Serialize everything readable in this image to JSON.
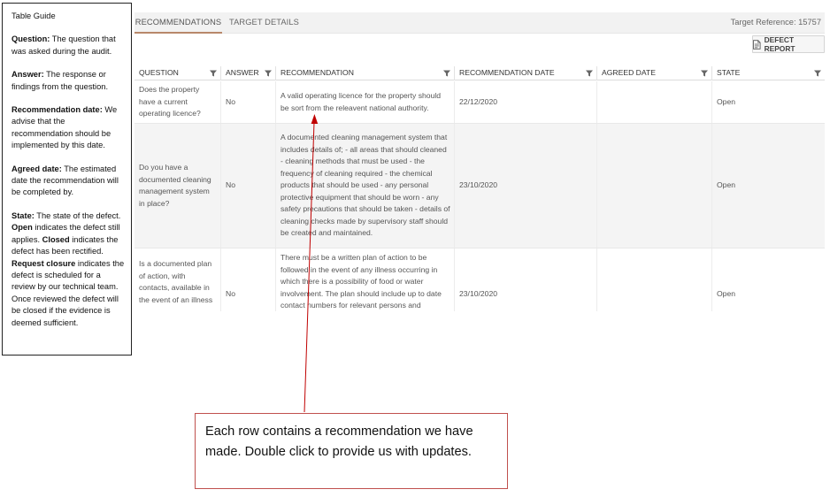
{
  "guide": {
    "title": "Table Guide",
    "question_term": "Question:",
    "question_text": " The question that was asked during the audit.",
    "answer_term": "Answer:",
    "answer_text": " The response or findings from the question.",
    "recdate_term": "Recommendation date:",
    "recdate_text": " We advise that the recommendation should be implemented by this date.",
    "agreed_term": "Agreed date:",
    "agreed_text": " The estimated date the recommendation will be completed by.",
    "state_term": "State:",
    "state_text1": " The state of the defect. ",
    "open_term": "Open",
    "state_text2": " indicates the defect still applies. ",
    "closed_term": "Closed",
    "state_text3": " indicates the defect has been rectified. ",
    "request_term": "Request closure",
    "state_text4": " indicates the defect is scheduled for a review by our technical team. Once reviewed the defect will be closed if the evidence is deemed sufficient."
  },
  "tabs": {
    "recommendations": "RECOMMENDATIONS",
    "target_details": "TARGET DETAILS"
  },
  "target_reference": "Target Reference: 15757",
  "defect_report_button": "DEFECT REPORT",
  "table": {
    "headers": [
      "QUESTION",
      "ANSWER",
      "RECOMMENDATION",
      "RECOMMENDATION DATE",
      "AGREED DATE",
      "STATE"
    ],
    "rows": [
      {
        "question": "Does the property have a current operating licence?",
        "answer": "No",
        "recommendation": "A valid operating licence for the property should be sort from the releavent national authority.",
        "recommendation_date": "22/12/2020",
        "agreed_date": "",
        "state": "Open"
      },
      {
        "question": "Do you have a documented cleaning management system in place?",
        "answer": "No",
        "recommendation": "A documented cleaning management system that includes details of; - all areas that should cleaned - cleaning methods that must be used - the frequency of cleaning required - the chemical products that should be used - any personal protective equipment that should be worn - any safety precautions that should be taken - details of cleaning checks made by supervisory staff should be created and maintained.",
        "recommendation_date": "23/10/2020",
        "agreed_date": "",
        "state": "Open"
      },
      {
        "question": "Is a documented plan of action, with contacts, available in the event of an illness",
        "answer": "No",
        "recommendation": "There must be a written plan of action to be followed in the event of any illness occurring in which there is a possibility of food or water involvement. The plan should include up to date contact numbers for relevant persons and",
        "recommendation_date": "23/10/2020",
        "agreed_date": "",
        "state": "Open"
      }
    ]
  },
  "callout": {
    "text": "Each row contains a recommendation we have made. Double click to provide us with updates."
  },
  "colors": {
    "callout_border": "#c0504d",
    "arrow": "#c00000",
    "active_tab_underline": "#b8886a"
  }
}
